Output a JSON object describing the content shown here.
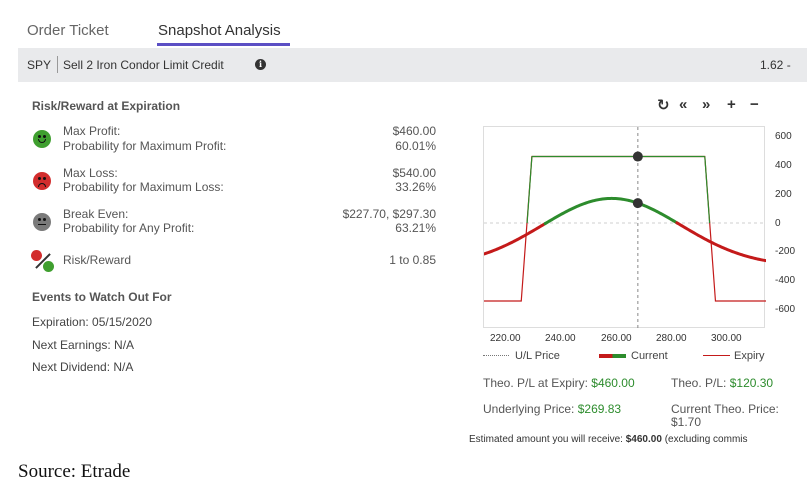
{
  "tabs": [
    {
      "label": "Order Ticket",
      "active": false
    },
    {
      "label": "Snapshot Analysis",
      "active": true
    }
  ],
  "header": {
    "symbol": "SPY",
    "strategy": "Sell 2 Iron Condor Limit Credit",
    "price": "1.62 -"
  },
  "risk_reward": {
    "title": "Risk/Reward at Expiration",
    "max_profit_label": "Max Profit:",
    "max_profit_value": "$460.00",
    "prob_max_profit_label": "Probability for Maximum Profit:",
    "prob_max_profit_value": "60.01%",
    "max_loss_label": "Max Loss:",
    "max_loss_value": "$540.00",
    "prob_max_loss_label": "Probability for Maximum Loss:",
    "prob_max_loss_value": "33.26%",
    "break_even_label": "Break Even:",
    "break_even_value": "$227.70, $297.30",
    "prob_any_profit_label": "Probability for Any Profit:",
    "prob_any_profit_value": "63.21%",
    "ratio_label": "Risk/Reward",
    "ratio_value": "1 to 0.85"
  },
  "events": {
    "title": "Events to Watch Out For",
    "expiration": "Expiration: 05/15/2020",
    "earnings": "Next Earnings: N/A",
    "dividend": "Next Dividend: N/A"
  },
  "toolbar": {
    "refresh_icon": "refresh-icon",
    "rewind_icon": "double-chevron-left-icon",
    "forward_icon": "double-chevron-right-icon",
    "zoom_in": "+",
    "zoom_out": "−"
  },
  "chart_data": {
    "type": "line",
    "x_ticks": [
      "220.00",
      "240.00",
      "260.00",
      "280.00",
      "300.00"
    ],
    "y_ticks": [
      "600",
      "400",
      "200",
      "0",
      "-200",
      "-400",
      "-600"
    ],
    "xlim": [
      212,
      318
    ],
    "ylim": [
      -650,
      650
    ],
    "underlying_price": 269.83,
    "series": [
      {
        "name": "Expiry",
        "color": "#c41a1a",
        "points": [
          [
            212,
            -540
          ],
          [
            226,
            -540
          ],
          [
            230,
            460
          ],
          [
            295,
            460
          ],
          [
            299,
            -540
          ],
          [
            318,
            -540
          ]
        ],
        "marker": [
          269.83,
          460
        ]
      },
      {
        "name": "Current",
        "colors": {
          "loss": "#c41a1a",
          "profit": "#2d8c2d"
        },
        "center": 260,
        "peak": 170,
        "sigma": 26,
        "marker": [
          269.83,
          120.3
        ]
      }
    ],
    "legend": [
      {
        "label": "U/L Price"
      },
      {
        "label": "Current"
      },
      {
        "label": "Expiry"
      }
    ]
  },
  "theo": {
    "pl_expiry_label": "Theo. P/L at Expiry:",
    "pl_expiry_value": "$460.00",
    "pl_label": "Theo. P/L:",
    "pl_value": "$120.30",
    "underlying_label": "Underlying Price:",
    "underlying_value": "$269.83",
    "current_price_label": "Current Theo. Price:",
    "current_price_value": "$1.70",
    "estimate_label": "Estimated amount you will receive:",
    "estimate_value": "$460.00",
    "estimate_suffix": "(excluding commis"
  },
  "source": "Source: Etrade",
  "colors": {
    "accent": "#5b4fc4",
    "profit": "#2d8c2d",
    "loss": "#c41a1a"
  }
}
